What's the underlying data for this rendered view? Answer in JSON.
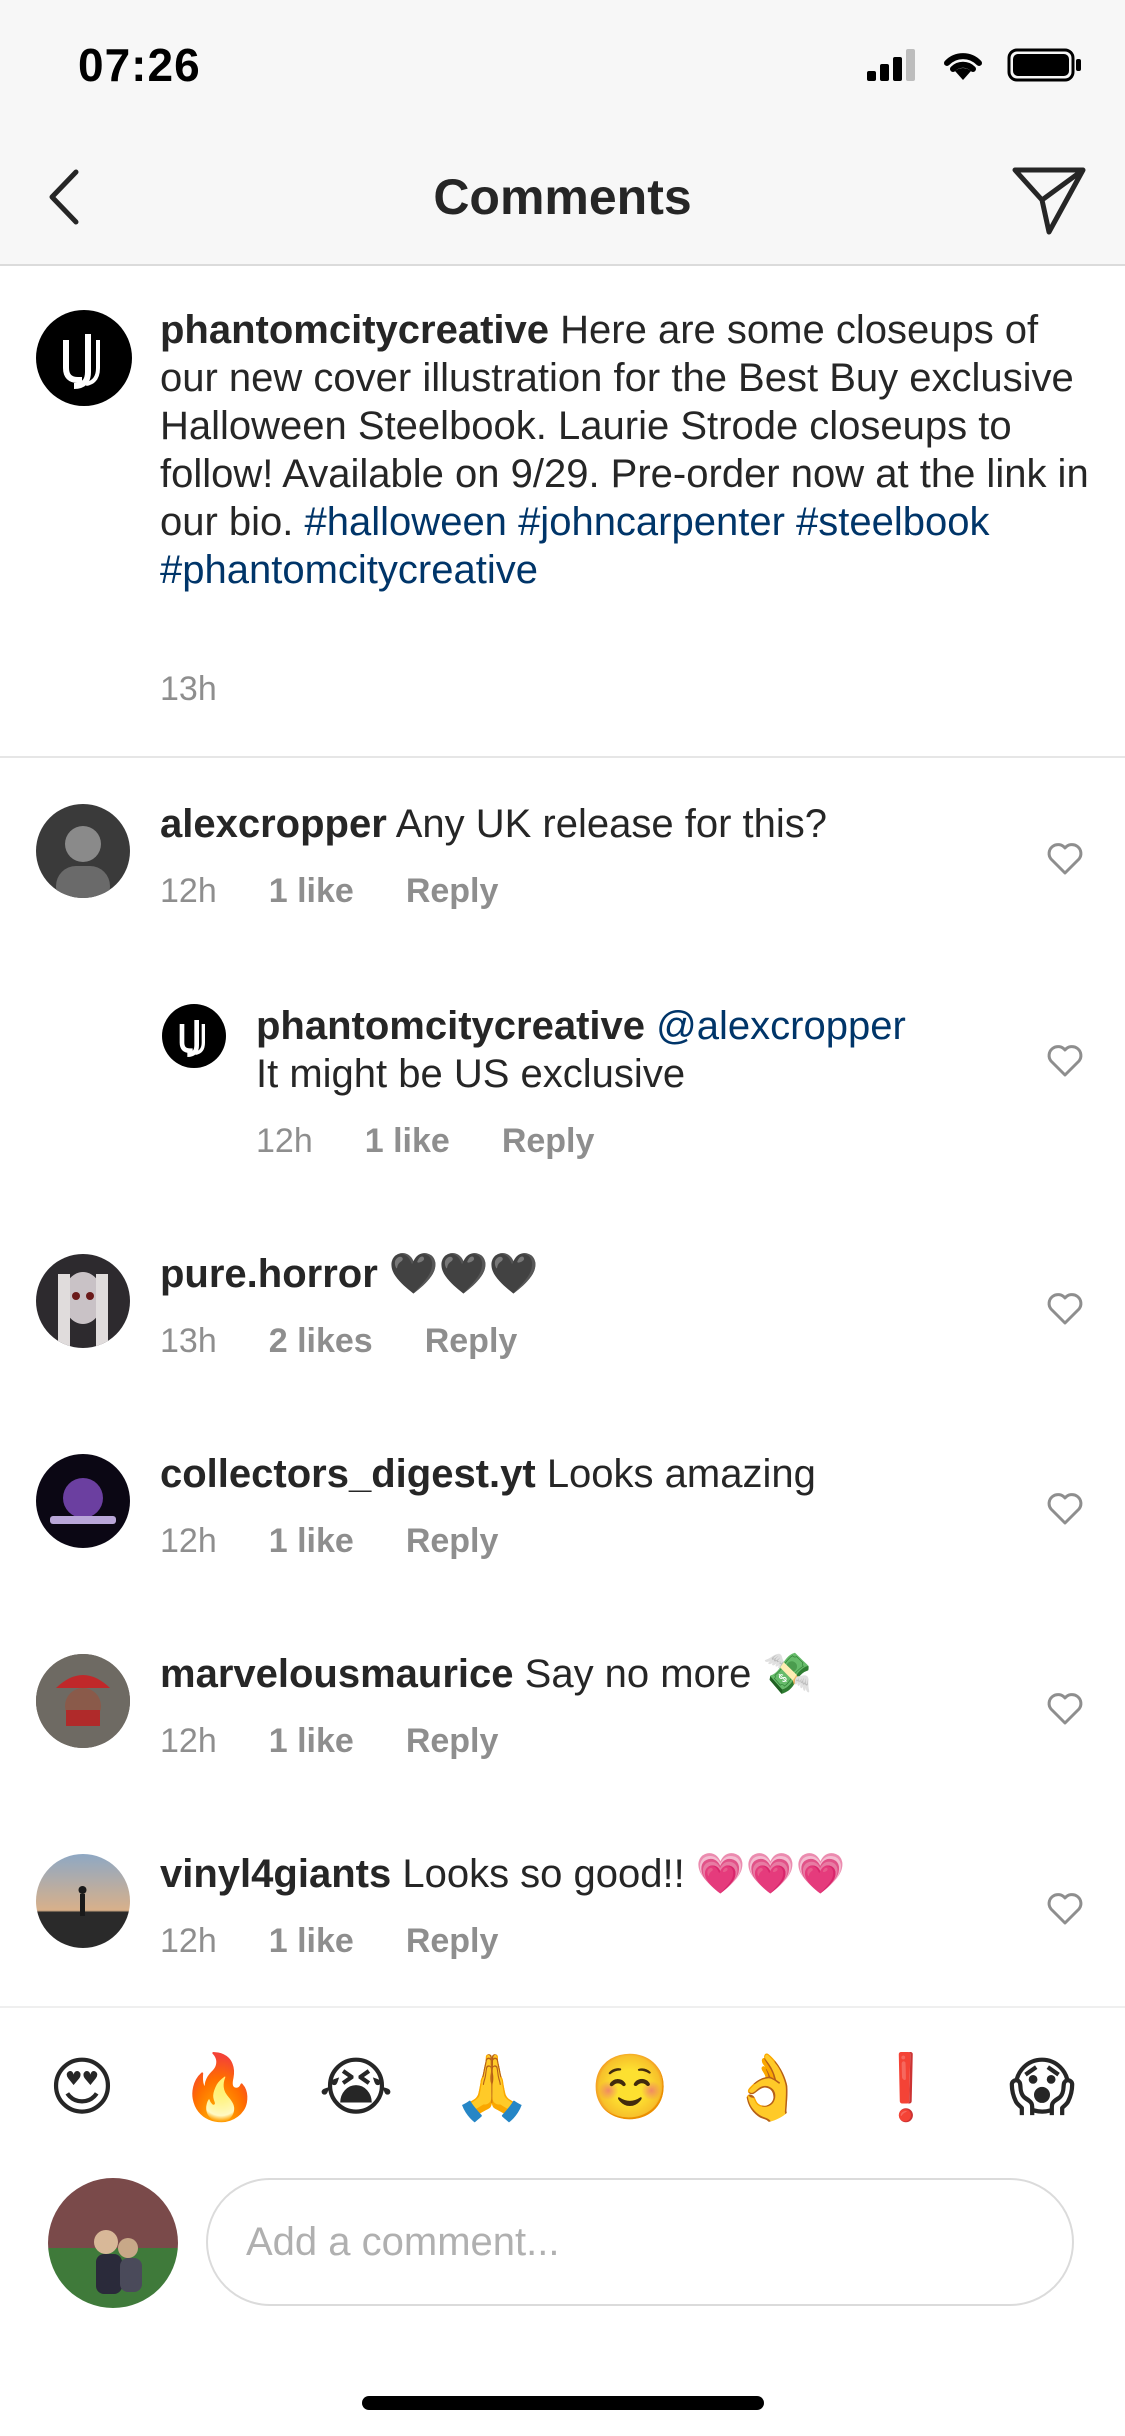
{
  "status_bar": {
    "time": "07:26"
  },
  "nav": {
    "title": "Comments"
  },
  "caption": {
    "username": "phantomcitycreative",
    "text": "Here are some closeups of our new cover illustration for the Best Buy exclusive Halloween Steelbook. Laurie Strode closeups to follow! Available on 9/29. Pre-order now at the link in our bio.",
    "hashtags": [
      "#halloween",
      "#johncarpenter",
      "#steelbook",
      "#phantomcitycreative"
    ],
    "time": "13h"
  },
  "comments": [
    {
      "username": "alexcropper",
      "text": "Any UK release for this?",
      "time": "12h",
      "likes": "1 like",
      "reply": "Reply"
    },
    {
      "username": "phantomcitycreative",
      "mention": "@alexcropper",
      "text": "It might be US exclusive",
      "time": "12h",
      "likes": "1 like",
      "reply": "Reply"
    },
    {
      "username": "pure.horror",
      "text": "🖤🖤🖤",
      "time": "13h",
      "likes": "2 likes",
      "reply": "Reply"
    },
    {
      "username": "collectors_digest.yt",
      "text": "Looks amazing",
      "time": "12h",
      "likes": "1 like",
      "reply": "Reply"
    },
    {
      "username": "marvelousmaurice",
      "text": "Say no more 💸",
      "time": "12h",
      "likes": "1 like",
      "reply": "Reply"
    },
    {
      "username": "vinyl4giants",
      "text": "Looks so good!! 💗💗💗",
      "time": "12h",
      "likes": "1 like",
      "reply": "Reply"
    }
  ],
  "quick_emojis": [
    "😍",
    "🔥",
    "😭",
    "🙏",
    "☺️",
    "👌",
    "❗",
    "😱"
  ],
  "composer": {
    "placeholder": "Add a comment..."
  },
  "colors": {
    "hashtag": "#003569",
    "meta": "#8e8e8e",
    "text": "#262626",
    "bar": "#f7f7f7"
  },
  "icons": [
    "back-chevron-icon",
    "send-icon",
    "heart-icon",
    "signal-icon",
    "wifi-icon",
    "battery-icon"
  ]
}
